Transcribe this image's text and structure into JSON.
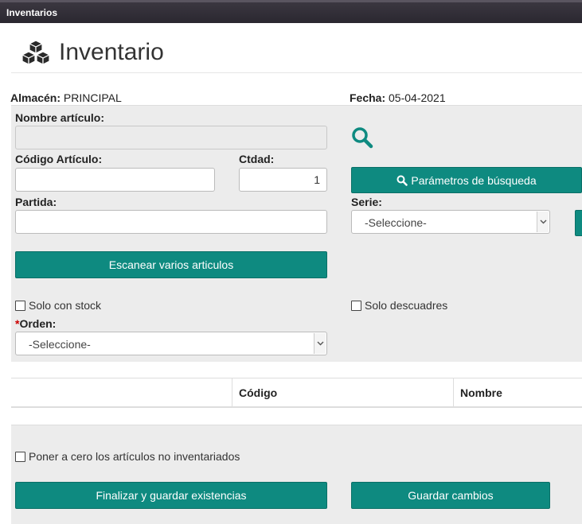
{
  "window": {
    "title": "Inventarios"
  },
  "header": {
    "title": "Inventario",
    "icon": "cubes-icon"
  },
  "info": {
    "almacen_label": "Almacén:",
    "almacen_value": "PRINCIPAL",
    "fecha_label": "Fecha:",
    "fecha_value": "05-04-2021"
  },
  "form": {
    "nombre_label": "Nombre artículo:",
    "nombre_value": "",
    "codigo_label": "Código Artículo:",
    "codigo_value": "",
    "ctdad_label": "Ctdad:",
    "ctdad_value": "1",
    "partida_label": "Partida:",
    "partida_value": "",
    "serie_label": "Serie:",
    "serie_value": "-Seleccione-",
    "params_button": "Parámetros de búsqueda",
    "scan_button": "Escanear varios articulos",
    "solo_stock_label": "Solo con stock",
    "solo_descuadres_label": "Solo descuadres",
    "orden_required": "*",
    "orden_label": "Orden:",
    "orden_value": "-Seleccione-"
  },
  "table": {
    "columns": [
      "",
      "Código",
      "Nombre"
    ]
  },
  "footer": {
    "reset_label": "Poner a cero los artículos no inventariados",
    "finalize_button": "Finalizar y guardar existencias",
    "save_button": "Guardar cambios"
  },
  "colors": {
    "accent": "#0e8a80",
    "titlebar": "#2a2730",
    "panel": "#ececec"
  }
}
